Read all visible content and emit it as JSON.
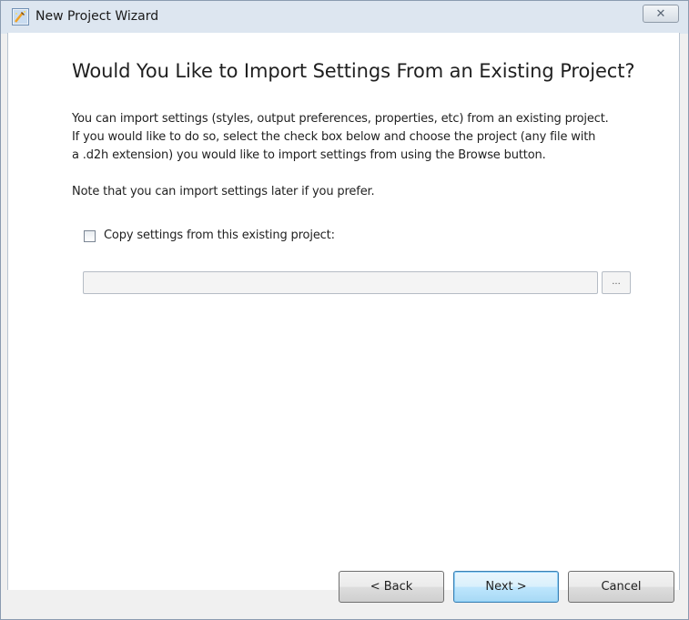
{
  "window": {
    "title": "New Project Wizard",
    "close_symbol": "✕"
  },
  "page": {
    "heading": "Would You Like to Import Settings From an Existing Project?",
    "paragraph_lines": [
      "You can import settings (styles, output preferences, properties, etc) from an existing project.",
      "If you would like to do so, select the check box below and choose the project (any file with",
      "a .d2h extension)  you would like to import settings from using the Browse button."
    ],
    "note": "Note that you can import settings later if you prefer.",
    "checkbox_label": "Copy settings from this existing project:",
    "checkbox_checked": false,
    "path_value": "",
    "browse_label": "..."
  },
  "buttons": {
    "back": "< Back",
    "next": "Next >",
    "cancel": "Cancel"
  },
  "icons": {
    "app": "wizard-app-icon",
    "close": "close-icon"
  }
}
